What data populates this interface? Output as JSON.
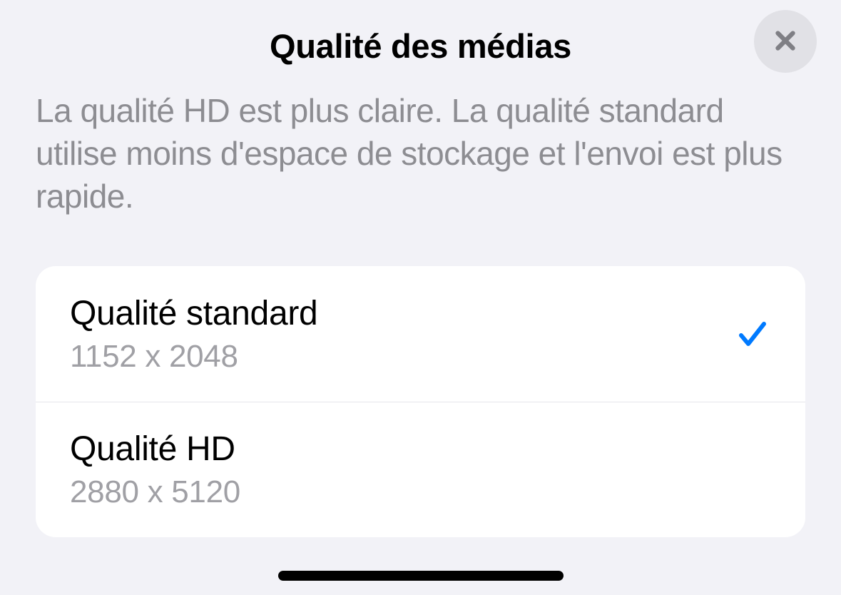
{
  "modal": {
    "title": "Qualité des médias",
    "description": "La qualité HD est plus claire. La qualité standard utilise moins d'espace de stockage et l'envoi est plus rapide."
  },
  "options": [
    {
      "label": "Qualité standard",
      "resolution": "1152 x 2048",
      "selected": true
    },
    {
      "label": "Qualité HD",
      "resolution": "2880 x 5120",
      "selected": false
    }
  ],
  "colors": {
    "accent": "#007aff",
    "background": "#f2f2f7",
    "card": "#ffffff",
    "textPrimary": "#000000",
    "textSecondary": "#8d8d92",
    "closeButtonBg": "#e1e1e6",
    "closeIconColor": "#7f7f85"
  }
}
